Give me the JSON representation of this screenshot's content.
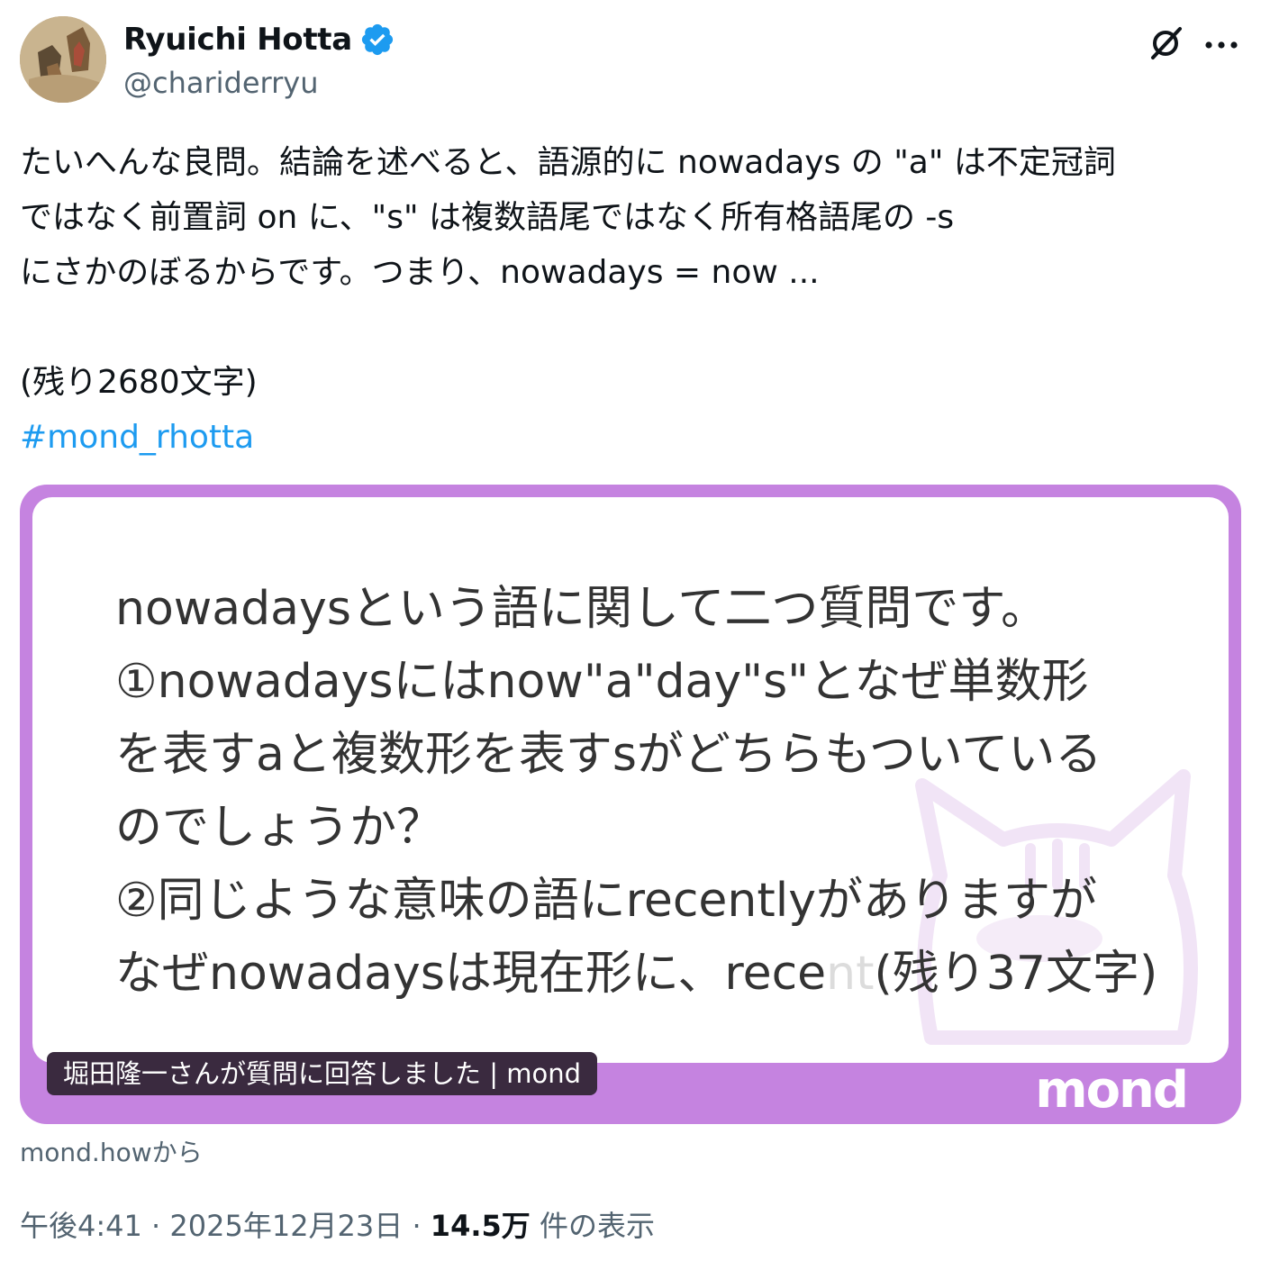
{
  "author": {
    "display_name": "Ryuichi Hotta",
    "handle": "@chariderryu",
    "verified": true,
    "avatar_icon": "profile-avatar"
  },
  "tweet": {
    "lines": [
      "たいへんな良問。結論を述べると、語源的に nowadays の \"a\" は不定冠詞",
      "ではなく前置詞 on に、\"s\" は複数語尾ではなく所有格語尾の -s",
      "にさかのぼるからです。つまり、nowadays = now ..."
    ],
    "remaining": "(残り2680文字)",
    "hashtag": "#mond_rhotta"
  },
  "card": {
    "question_lines": [
      "nowadaysという語に関して二つ質問です。",
      "①nowadaysにはnow\"a\"day\"s\"となぜ単数形",
      "を表すaと複数形を表すsがどちらもついている",
      "のでしょうか？",
      "②同じような意味の語にrecentlyがありますが"
    ],
    "last_line_main": "なぜnowadaysは現在形に、rece",
    "last_line_faded": "nt",
    "last_line_remaining": "(残り37文字)",
    "caption": "堀田隆一さんが質問に回答しました | mond",
    "logo": "mond",
    "accent_color": "#c583e0"
  },
  "source": "mond.howから",
  "meta": {
    "time": "午後4:41",
    "separator": " · ",
    "date": "2025年12月23日",
    "views_count": "14.5万",
    "views_label": " 件の表示"
  },
  "colors": {
    "link": "#1d9bf0",
    "secondary_text": "#536471",
    "verified_badge": "#1d9bf0"
  }
}
